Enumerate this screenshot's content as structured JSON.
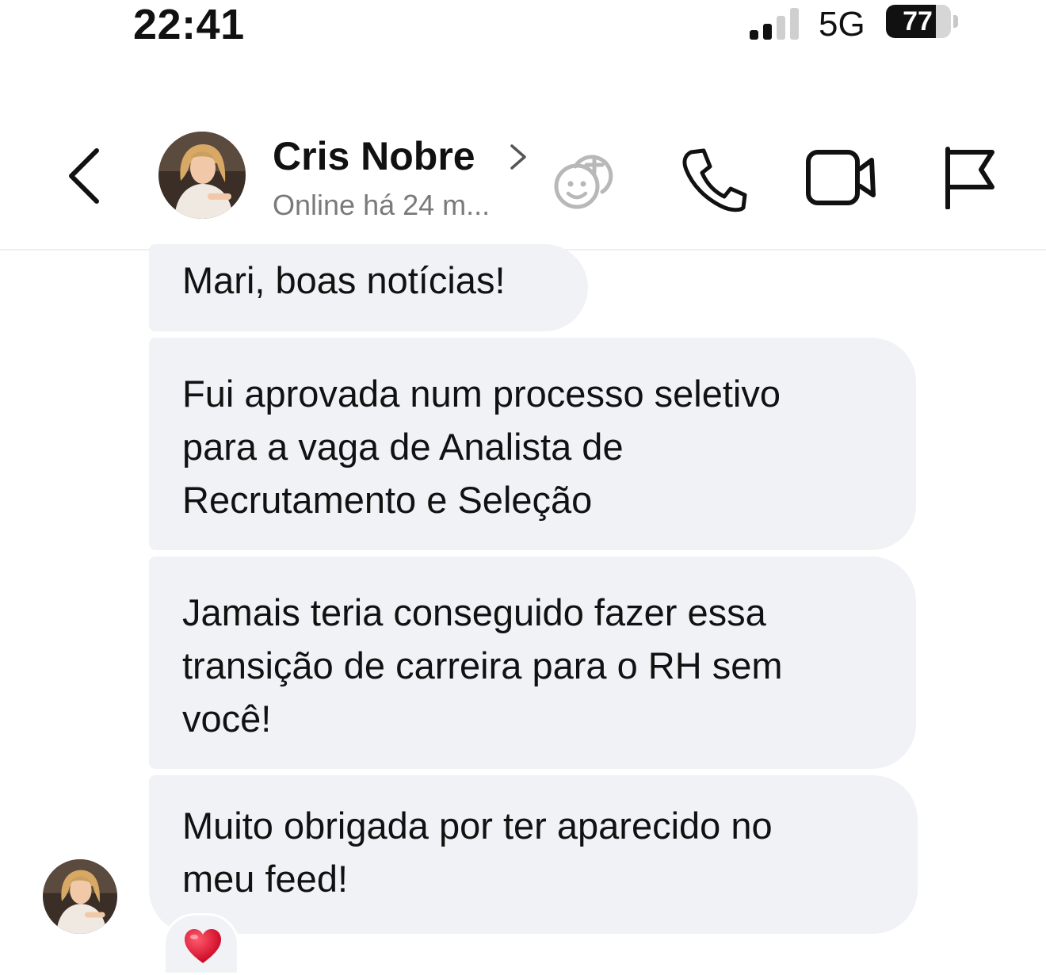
{
  "status_bar": {
    "time": "22:41",
    "network": "5G",
    "battery": "77",
    "battery_level": 0.77,
    "signal_bars_active": 2,
    "signal_bars_total": 4,
    "signal_icon": "cellular-signal-icon"
  },
  "header": {
    "back_icon": "chevron-left-icon",
    "contact_name": "Cris Nobre",
    "name_chevron_icon": "chevron-right-icon",
    "contact_status": "Online há 24 m...",
    "actions": [
      {
        "icon": "sticker-add-icon"
      },
      {
        "icon": "phone-icon"
      },
      {
        "icon": "video-camera-icon"
      },
      {
        "icon": "flag-icon"
      }
    ]
  },
  "messages": [
    {
      "lines": [
        "Mari, boas notícias!"
      ]
    },
    {
      "lines": [
        "Fui aprovada num processo seletivo",
        "para a vaga de Analista de",
        "Recrutamento e Seleção"
      ]
    },
    {
      "lines": [
        "Jamais teria conseguido fazer essa",
        "transição de carreira para o RH sem",
        "você!"
      ]
    },
    {
      "lines": [
        "Muito obrigada por ter aparecido no",
        "meu feed!"
      ]
    }
  ],
  "reaction": {
    "emoji": "❤️",
    "icon": "heart-icon"
  },
  "colors": {
    "bubble_bg": "#f0f2f5",
    "text": "#111111",
    "muted_text": "#7a7a7a",
    "heart": "#e0102a"
  }
}
